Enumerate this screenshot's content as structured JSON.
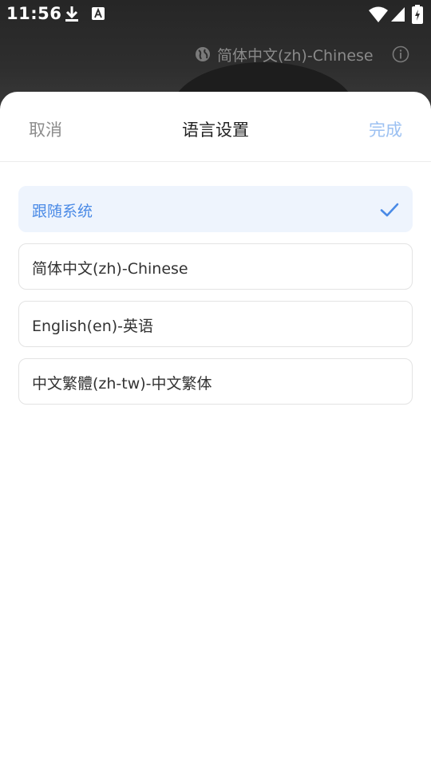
{
  "status_bar": {
    "time": "11:56",
    "icons": [
      "download-icon",
      "a-icon",
      "wifi-icon",
      "signal-icon",
      "battery-icon"
    ]
  },
  "background": {
    "language_label": "简体中文(zh)-Chinese",
    "icons": [
      "globe-icon",
      "info-icon"
    ]
  },
  "sheet": {
    "cancel_label": "取消",
    "title": "语言设置",
    "done_label": "完成",
    "options": [
      {
        "label": "跟随系统",
        "selected": true
      },
      {
        "label": "简体中文(zh)-Chinese",
        "selected": false
      },
      {
        "label": "English(en)-英语",
        "selected": false
      },
      {
        "label": "中文繁體(zh-tw)-中文繁体",
        "selected": false
      }
    ]
  },
  "colors": {
    "accent": "#4a8ae6",
    "done_inactive": "#9cc1f2",
    "selected_bg": "#eef4fd",
    "cancel_text": "#8c8c8c"
  }
}
